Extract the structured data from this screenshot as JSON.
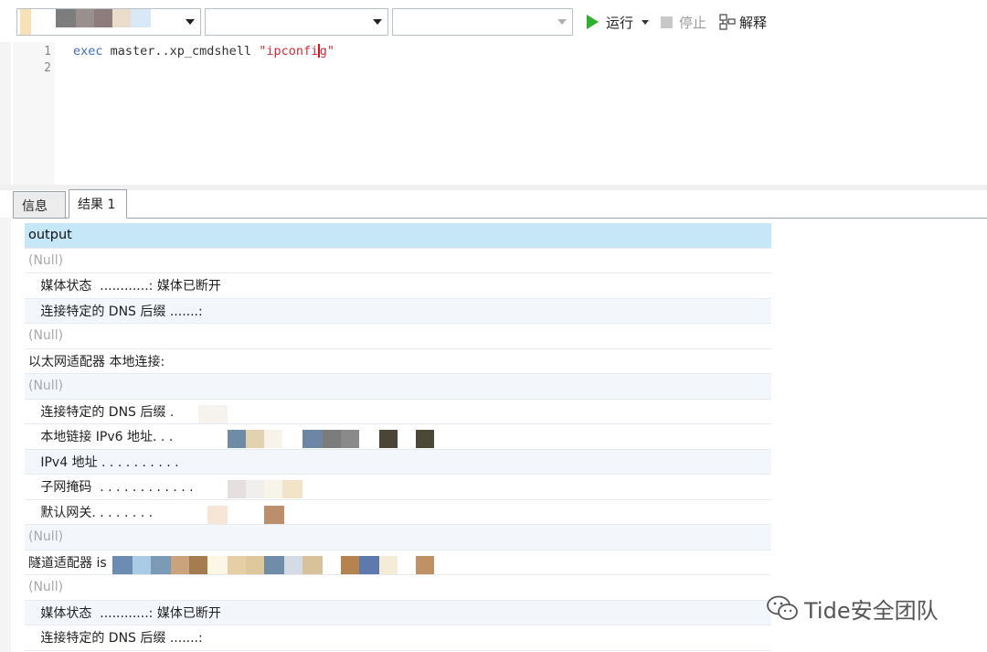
{
  "toolbar": {
    "run_label": "运行",
    "stop_label": "停止",
    "explain_label": "解释",
    "icons": {
      "run": "play-icon",
      "stop": "stop-icon",
      "explain": "explain-plan-icon"
    }
  },
  "editor": {
    "line_numbers": [
      "1",
      "2"
    ],
    "code": {
      "keyword": "exec",
      "rest": " master..xp_cmdshell ",
      "string_open": "\"ipconfi",
      "string_close": "g\""
    }
  },
  "tabs": [
    {
      "label": "信息"
    },
    {
      "label": "结果 1"
    }
  ],
  "grid": {
    "column_header": "output",
    "rows": [
      "(Null)",
      "   媒体状态  ............: 媒体已断开",
      "   连接特定的 DNS 后缀 .......:",
      "(Null)",
      "以太网适配器 本地连接:",
      "(Null)",
      "   连接特定的 DNS 后缀 .       :",
      "   本地链接 IPv6 地址. . .",
      "   IPv4 地址 . . . . . . . . . .",
      "   子网掩码  . . . . . . . . . . . .",
      "   默认网关. . . . . . . .",
      "(Null)",
      "隧道适配器 is",
      "(Null)",
      "   媒体状态  ............: 媒体已断开",
      "   连接特定的 DNS 后缀 .......:"
    ]
  },
  "watermark": {
    "text": "Tide安全团队",
    "icon": "wechat-icon"
  },
  "colors": {
    "header_row": "#c6e7f8",
    "alt_row": "#f3f7fb",
    "keyword": "#3b6fc4",
    "string": "#d02a3a",
    "run_green": "#2fb02f"
  }
}
